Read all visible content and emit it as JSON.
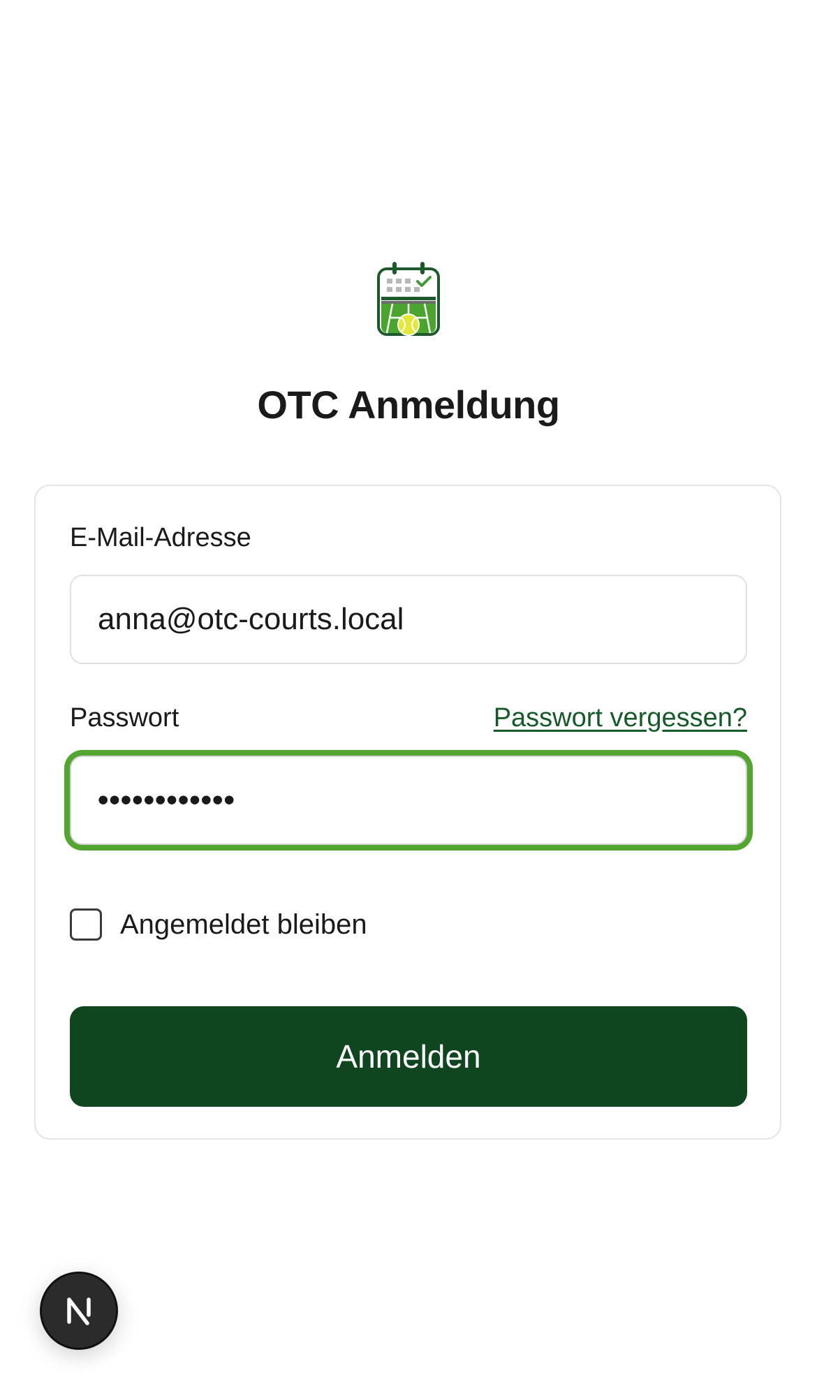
{
  "header": {
    "logo_icon": "tennis-court-calendar-icon",
    "title": "OTC Anmeldung"
  },
  "form": {
    "email": {
      "label": "E-Mail-Adresse",
      "value": "anna@otc-courts.local"
    },
    "password": {
      "label": "Passwort",
      "value": "••••••••••••",
      "forgot_link": "Passwort vergessen?",
      "focused": true
    },
    "remember": {
      "label": "Angemeldet bleiben",
      "checked": false
    },
    "submit_label": "Anmelden"
  },
  "dev_badge": {
    "icon": "nextjs-icon"
  },
  "colors": {
    "primary": "#0f4620",
    "focus_ring": "#52a52e",
    "link": "#175a2a",
    "border": "#e4e4e4"
  }
}
